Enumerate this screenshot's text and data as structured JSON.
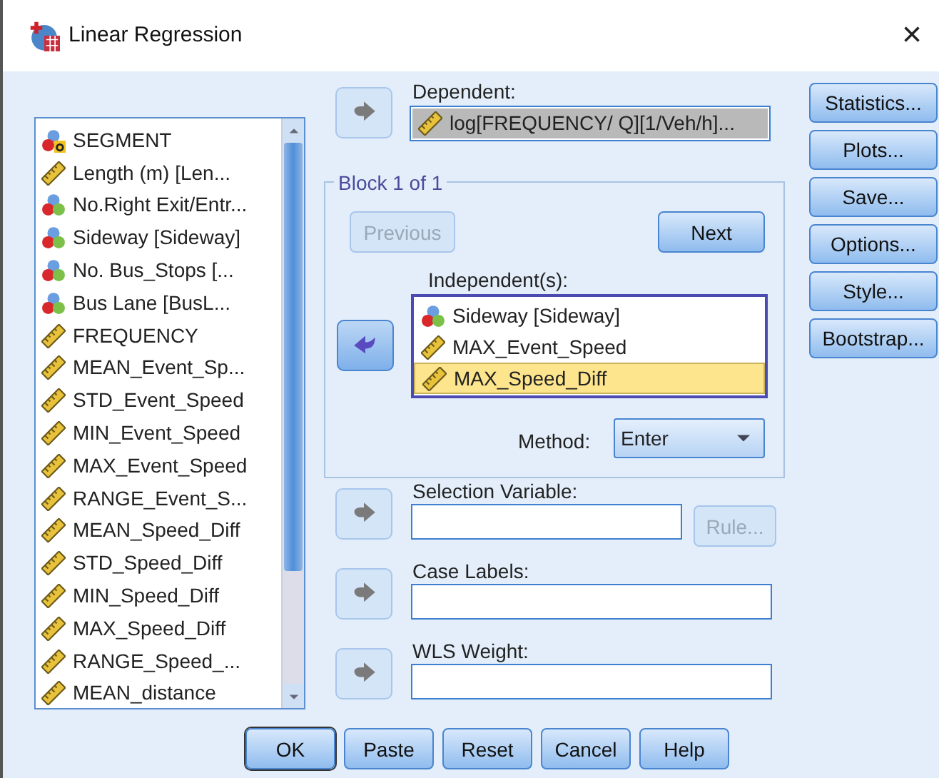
{
  "window": {
    "title": "Linear Regression",
    "close": "×"
  },
  "variables": [
    {
      "label": "SEGMENT",
      "kind": "string_nominal"
    },
    {
      "label": "Length (m)  [Len...",
      "kind": "scale"
    },
    {
      "label": "No.Right Exit/Entr...",
      "kind": "nominal"
    },
    {
      "label": "Sideway  [Sideway]",
      "kind": "nominal"
    },
    {
      "label": "No. Bus_Stops  [...",
      "kind": "nominal"
    },
    {
      "label": "Bus Lane  [BusL...",
      "kind": "nominal"
    },
    {
      "label": "FREQUENCY",
      "kind": "scale"
    },
    {
      "label": "MEAN_Event_Sp...",
      "kind": "scale"
    },
    {
      "label": "STD_Event_Speed",
      "kind": "scale"
    },
    {
      "label": "MIN_Event_Speed",
      "kind": "scale"
    },
    {
      "label": "MAX_Event_Speed",
      "kind": "scale"
    },
    {
      "label": "RANGE_Event_S...",
      "kind": "scale"
    },
    {
      "label": "MEAN_Speed_Diff",
      "kind": "scale"
    },
    {
      "label": "STD_Speed_Diff",
      "kind": "scale"
    },
    {
      "label": "MIN_Speed_Diff",
      "kind": "scale"
    },
    {
      "label": "MAX_Speed_Diff",
      "kind": "scale"
    },
    {
      "label": "RANGE_Speed_...",
      "kind": "scale"
    },
    {
      "label": "MEAN_distance",
      "kind": "scale"
    }
  ],
  "dependent": {
    "arrow": {
      "kind": "add",
      "disabled": true
    },
    "label": "Dependent:",
    "value": "log[FREQUENCY/ Q][1/Veh/h]...",
    "kind": "scale"
  },
  "block": {
    "title": "Block 1 of 1",
    "previous": {
      "label": "Previous",
      "disabled": true
    },
    "next": {
      "label": "Next",
      "disabled": false
    },
    "arrow": {
      "kind": "remove",
      "disabled": false
    },
    "independents_label": "Independent(s):",
    "independents": [
      {
        "label": "Sideway  [Sideway]",
        "kind": "nominal",
        "selected": false
      },
      {
        "label": "MAX_Event_Speed",
        "kind": "scale",
        "selected": false
      },
      {
        "label": "MAX_Speed_Diff",
        "kind": "scale",
        "selected": true
      }
    ],
    "method_label": "Method:",
    "method": "Enter"
  },
  "selection_variable": {
    "arrow": {
      "kind": "add",
      "disabled": true
    },
    "label": "Selection Variable:",
    "rule": {
      "label": "Rule...",
      "disabled": true
    }
  },
  "case_labels": {
    "arrow": {
      "kind": "add",
      "disabled": true
    },
    "label": "Case Labels:"
  },
  "wls_weight": {
    "arrow": {
      "kind": "add",
      "disabled": true
    },
    "label": "WLS Weight:"
  },
  "side_buttons": [
    {
      "label": "Statistics..."
    },
    {
      "label": "Plots..."
    },
    {
      "label": "Save..."
    },
    {
      "label": "Options..."
    },
    {
      "label": "Style..."
    },
    {
      "label": "Bootstrap..."
    }
  ],
  "bottom_buttons": [
    {
      "label": "OK",
      "default": true
    },
    {
      "label": "Paste",
      "default": false
    },
    {
      "label": "Reset",
      "default": false
    },
    {
      "label": "Cancel",
      "default": false
    },
    {
      "label": "Help",
      "default": false
    }
  ]
}
